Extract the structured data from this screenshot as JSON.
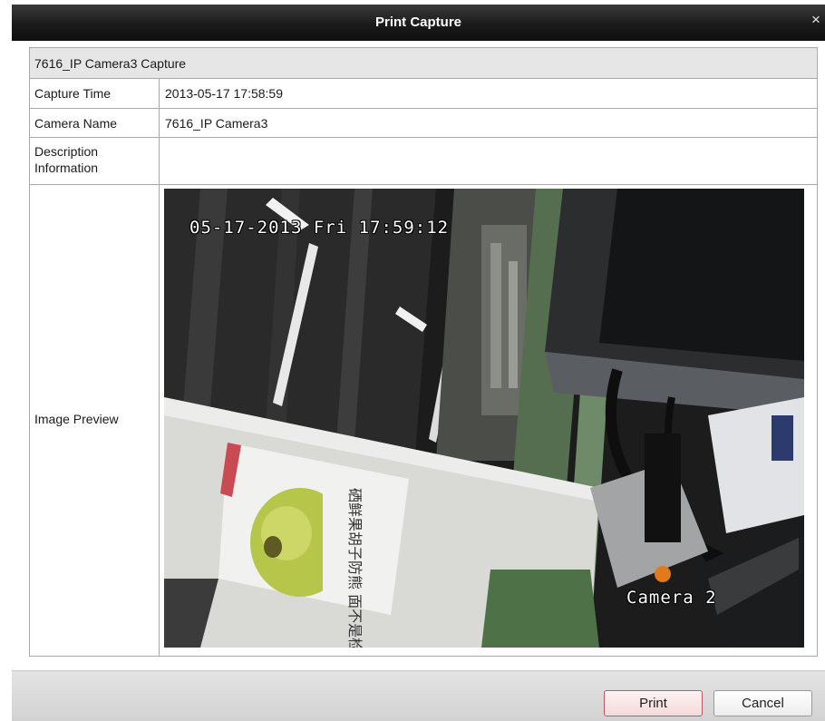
{
  "window": {
    "title": "Print Capture",
    "close_glyph": "×"
  },
  "table": {
    "header": "7616_IP Camera3 Capture",
    "rows": [
      {
        "label": "Capture Time",
        "value": "2013-05-17 17:58:59"
      },
      {
        "label": "Camera Name",
        "value": "7616_IP Camera3"
      },
      {
        "label_line1": "Description",
        "label_line2": "Information",
        "value": ""
      },
      {
        "label": "Image Preview"
      }
    ]
  },
  "preview": {
    "osd_timestamp": "05-17-2013 Fri 17:59:12",
    "osd_camera": "Camera 2",
    "sign_text": "硒鲜果胡子防熊 面不是检验"
  },
  "footer": {
    "print_label": "Print",
    "cancel_label": "Cancel"
  },
  "colors": {
    "titlebar": "#1b1b1b",
    "header_row": "#e6e6e6",
    "print_border": "#c45a5a"
  }
}
